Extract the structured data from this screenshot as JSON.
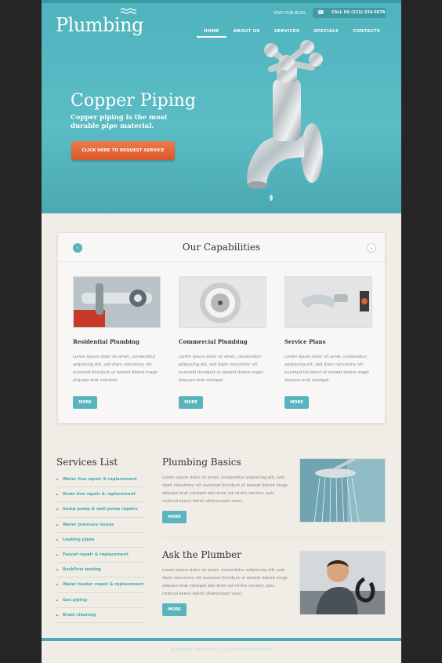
{
  "header": {
    "logo": "Plumbing",
    "blog_link": "VISIT OUR BLOG",
    "phone": "CALL US (111) 234-5678",
    "nav": [
      "HOME",
      "ABOUT US",
      "SERVICES",
      "SPECIALS",
      "CONTACTS"
    ]
  },
  "hero": {
    "title": "Copper Piping",
    "subtitle": "Copper piping is the most durable pipe material.",
    "button": "CLICK HERE TO REQUEST SERVICE"
  },
  "capabilities": {
    "title": "Our Capabilities",
    "items": [
      {
        "title": "Residential Plumbing",
        "text": "Lorem ipsum dolor sit amet, consectetur adipiscing elit, sed diam nonummy nih euismod tincidunt ut laoreet dolore magn aliquam erat volutpat.",
        "button": "MORE"
      },
      {
        "title": "Commercial Plumbing",
        "text": "Lorem ipsum dolor sit amet, consectetur adipiscing elit, sed diam nonummy nih euismod tincidunt ut laoreet dolore magn aliquam erat volutpat.",
        "button": "MORE"
      },
      {
        "title": "Service Plans",
        "text": "Lorem ipsum dolor sit amet, consectetur adipiscing elit, sed diam nonummy nih euismod tincidunt ut laoreet dolore magn aliquam erat volutpat.",
        "button": "MORE"
      }
    ]
  },
  "services": {
    "title": "Services List",
    "items": [
      "Water line repair & replacement",
      "Drain line repair & replacement",
      "Sump pump & well pump repairs",
      "Water pressure issues",
      "Leaking pipes",
      "Faucet repair & replacement",
      "Backflow testing",
      "Water heater repair & replacement",
      "Gas piping",
      "Drain cleaning"
    ]
  },
  "basics": {
    "title": "Plumbing Basics",
    "text": "Lorem ipsum dolor sit amet, consectetur adipiscing elit, sed diam nonummy nih euismod tincidunt ut laoreet dolore magn aliquam erat volutpat wisi enim ad minim veniam, quis nostrud exerci tation ullamcorper susci.",
    "button": "MORE"
  },
  "ask": {
    "title": "Ask the Plumber",
    "text": "Lorem ipsum dolor sit amet, consectetur adipiscing elit, sed diam nonummy nih euismod tincidunt ut laoreet dolore magn aliquam erat volutpat wisi enim ad minim veniam, quis nostrud exerci tation ullamcorper susci.",
    "button": "MORE"
  },
  "footer": {
    "text": "PLUMBING SERVICES © 2012 PRIVACY POLICY"
  },
  "colors": {
    "accent": "#5ab4bd",
    "hero": "#4fb3bd",
    "cta": "#e8663a"
  }
}
